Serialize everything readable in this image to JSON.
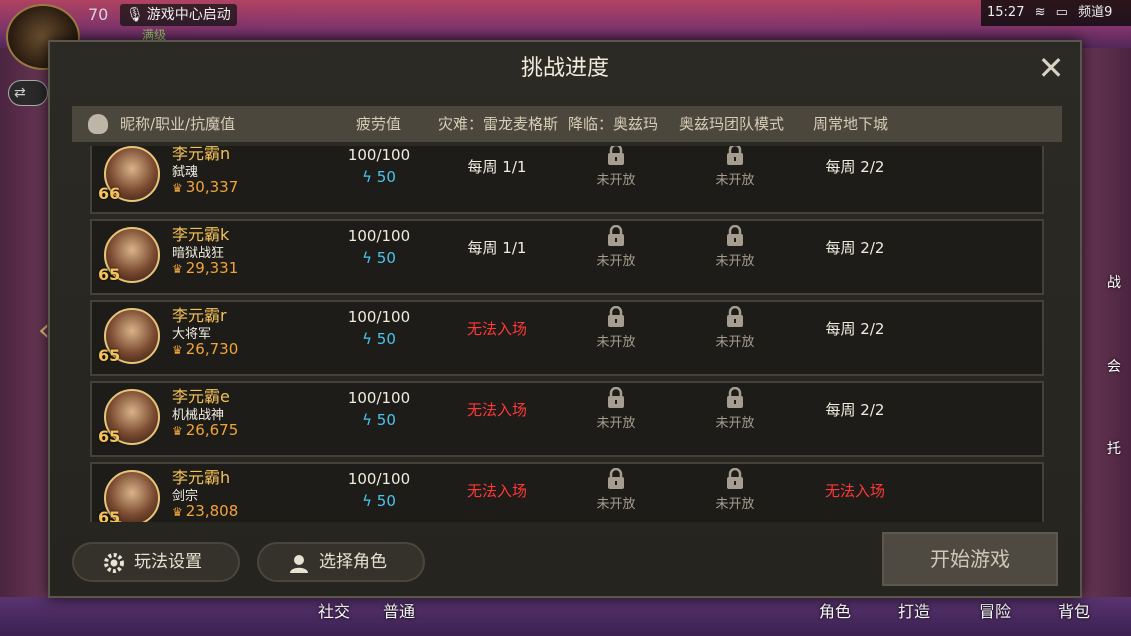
{
  "status": {
    "level": "70",
    "game_center": "游戏中心启动",
    "full_tag": "满级",
    "time": "15:27",
    "channel": "频道9"
  },
  "modal": {
    "title": "挑战进度",
    "headers": {
      "nickname": "昵称/职业/抗魔值",
      "fatigue": "疲劳值",
      "disaster": "灾难：雷龙麦格斯",
      "descend": "降临：奥兹玛",
      "raid": "奥兹玛团队模式",
      "weekly": "周常地下城"
    },
    "rows": [
      {
        "level": "66",
        "name": "李元霸n",
        "job": "弑魂",
        "power": "30,337",
        "fatigue": "100/100",
        "energy": "50",
        "disaster": "每周 1/1",
        "disaster_red": false,
        "descend": "未开放",
        "raid": "未开放",
        "weekly": "每周 2/2",
        "weekly_red": false
      },
      {
        "level": "65",
        "name": "李元霸k",
        "job": "暗狱战狂",
        "power": "29,331",
        "fatigue": "100/100",
        "energy": "50",
        "disaster": "每周 1/1",
        "disaster_red": false,
        "descend": "未开放",
        "raid": "未开放",
        "weekly": "每周 2/2",
        "weekly_red": false
      },
      {
        "level": "65",
        "name": "李元霸r",
        "job": "大将军",
        "power": "26,730",
        "fatigue": "100/100",
        "energy": "50",
        "disaster": "无法入场",
        "disaster_red": true,
        "descend": "未开放",
        "raid": "未开放",
        "weekly": "每周 2/2",
        "weekly_red": false
      },
      {
        "level": "65",
        "name": "李元霸e",
        "job": "机械战神",
        "power": "26,675",
        "fatigue": "100/100",
        "energy": "50",
        "disaster": "无法入场",
        "disaster_red": true,
        "descend": "未开放",
        "raid": "未开放",
        "weekly": "每周 2/2",
        "weekly_red": false
      },
      {
        "level": "65",
        "name": "李元霸h",
        "job": "剑宗",
        "power": "23,808",
        "fatigue": "100/100",
        "energy": "50",
        "disaster": "无法入场",
        "disaster_red": true,
        "descend": "未开放",
        "raid": "未开放",
        "weekly": "无法入场",
        "weekly_red": true
      }
    ],
    "buttons": {
      "settings": "玩法设置",
      "select_char": "选择角色",
      "start": "开始游戏"
    }
  },
  "background": {
    "bottom_labels": [
      "社交",
      "普通",
      "角色",
      "打造",
      "冒险",
      "背包"
    ],
    "right_labels": [
      "战",
      "会",
      "托"
    ]
  },
  "colors": {
    "accent_gold": "#f6c35a",
    "energy_blue": "#49c6ef",
    "warning_red": "#ff3838"
  }
}
